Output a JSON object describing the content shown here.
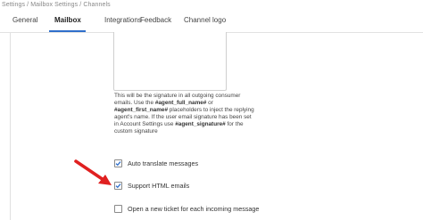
{
  "breadcrumb": "Settings / Mailbox Settings / Channels",
  "tabs": [
    {
      "label": "General",
      "active": false
    },
    {
      "label": "Mailbox",
      "active": true
    },
    {
      "label": "Integrations",
      "active": false
    },
    {
      "label": "Feedback",
      "active": false
    },
    {
      "label": "Channel logo",
      "active": false
    }
  ],
  "signature": {
    "help": {
      "p1": "This will be the signature in all outgoing consumer emails. Use the ",
      "ph1": "#agent_full_name#",
      "p2": " or ",
      "ph2": "#agent_first_name#",
      "p3": " placeholders to inject the replying agent's name. If the user email signature has been set in Account Settings use ",
      "ph3": "#agent_signature#",
      "p4": " for the custom signature"
    }
  },
  "options": [
    {
      "label": "Auto translate messages",
      "checked": true
    },
    {
      "label": "Support HTML emails",
      "checked": true
    },
    {
      "label": "Open a new ticket for each incoming message",
      "checked": false
    }
  ],
  "colors": {
    "accent": "#2f6fcb",
    "arrow": "#e02020"
  }
}
